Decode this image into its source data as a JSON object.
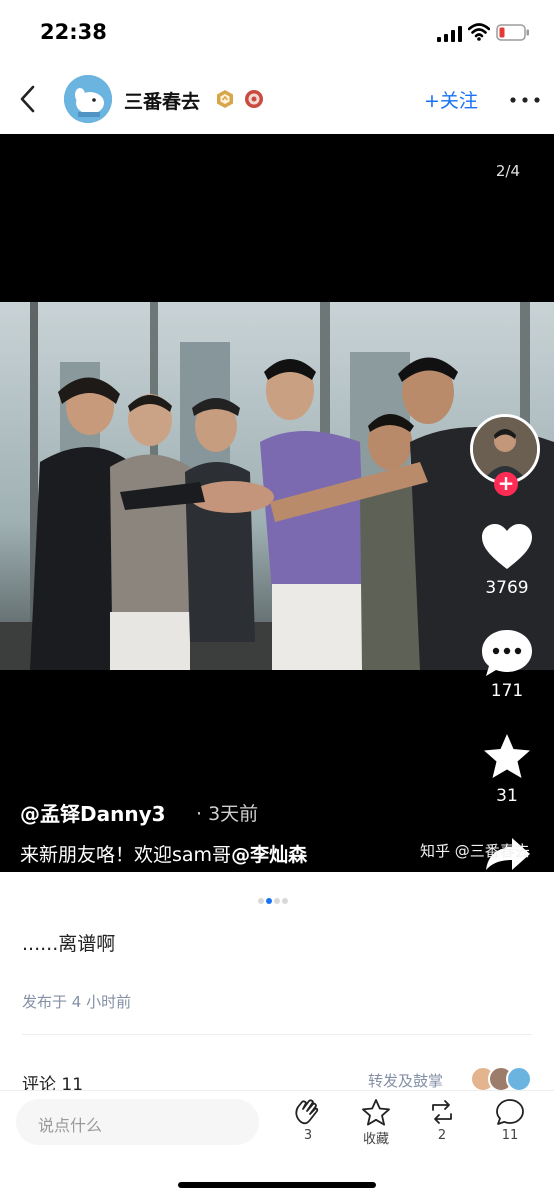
{
  "status_bar": {
    "time": "22:38"
  },
  "header": {
    "username": "三番春去",
    "follow_label": "+关注",
    "accent_color": "#1772f6"
  },
  "media": {
    "pager": "2/4",
    "stats": {
      "likes": "3769",
      "comments": "171",
      "stars": "31"
    },
    "author": "@孟铎Danny3",
    "time": "· 3天前",
    "caption_prefix": "来新朋友咯！欢迎sam哥",
    "caption_mention": "@李灿森",
    "watermark": "知乎 @三番春去"
  },
  "post": {
    "text": "......离谱啊",
    "published": "发布于 4 小时前",
    "comments_title": "评论 11",
    "repost_label": "转发及鼓掌"
  },
  "bottom_bar": {
    "placeholder": "说点什么",
    "clap_count": "3",
    "favorite_label": "收藏",
    "repost_count": "2",
    "comment_count": "11"
  }
}
